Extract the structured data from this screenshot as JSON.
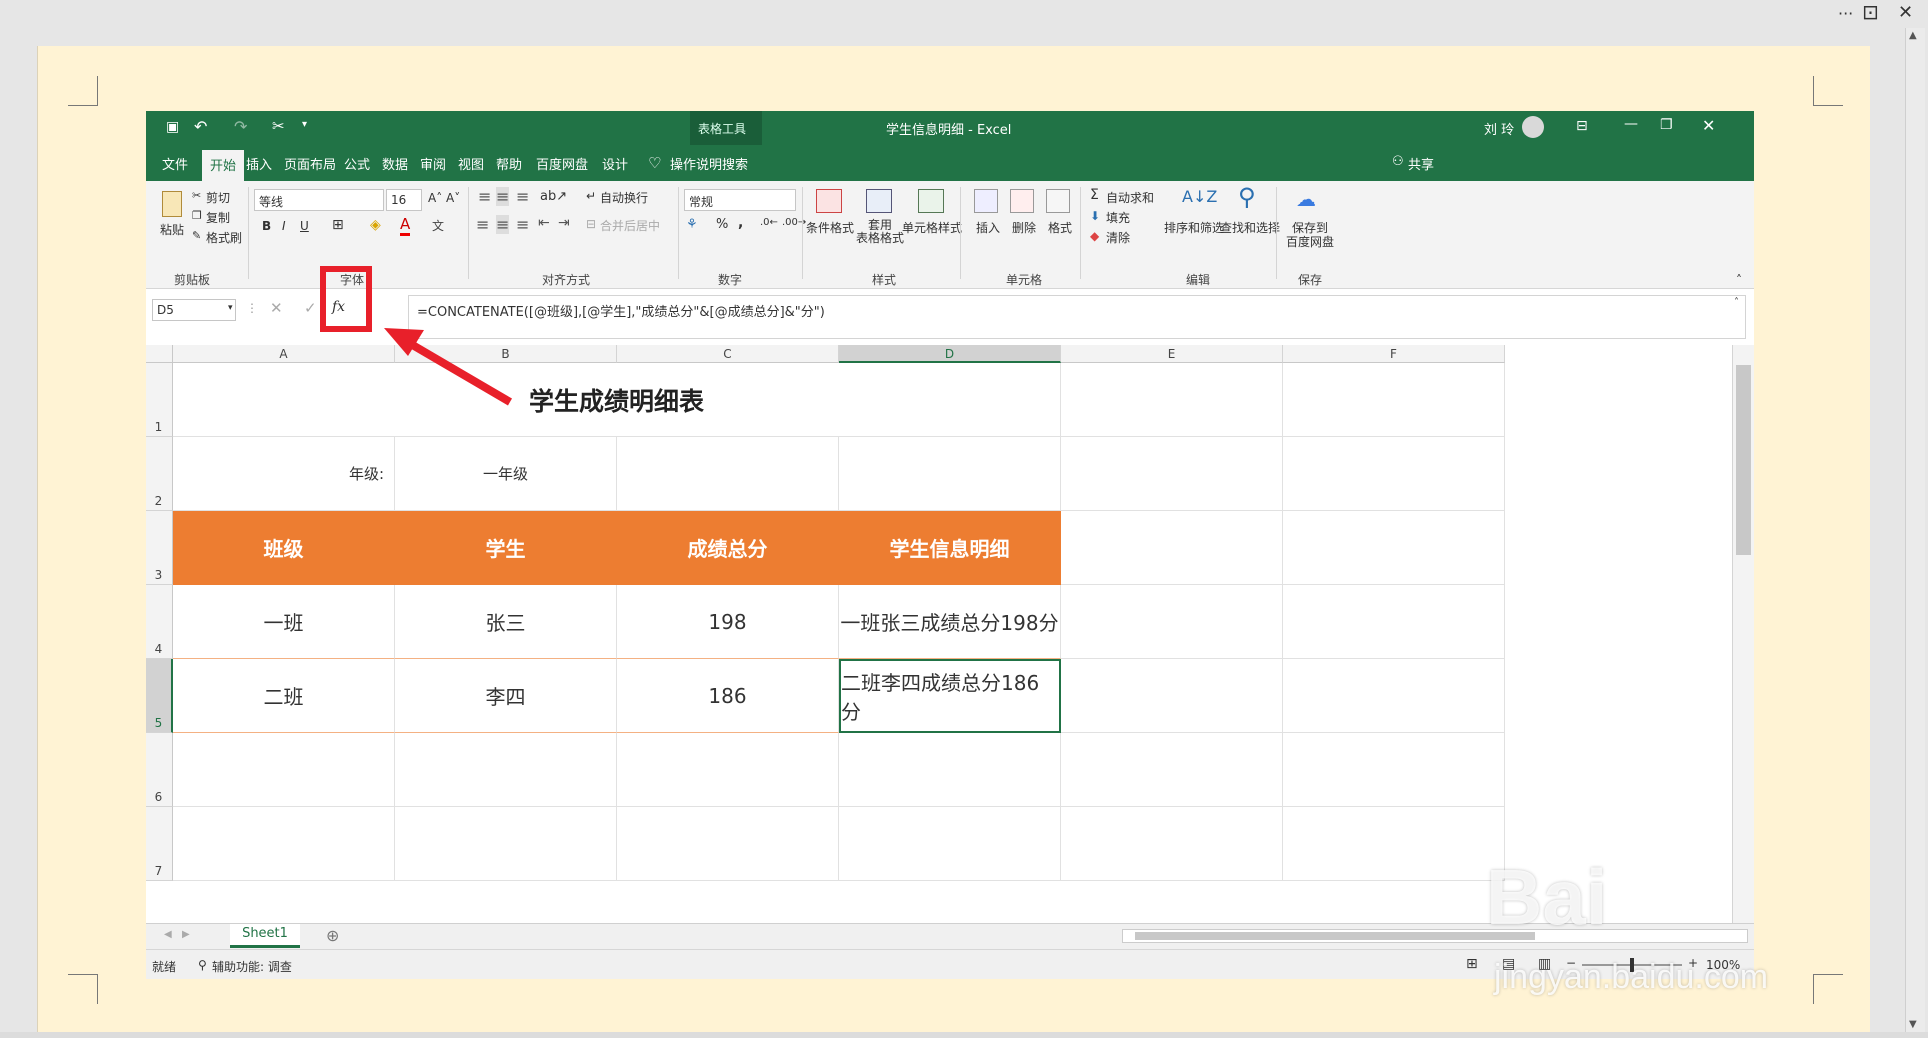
{
  "window": {
    "more": "···",
    "restore": "⊡",
    "close": "✕"
  },
  "excel": {
    "title": "学生信息明细 - Excel",
    "context_tool": "表格工具",
    "user": "刘 玲",
    "tabs": [
      "文件",
      "开始",
      "插入",
      "页面布局",
      "公式",
      "数据",
      "审阅",
      "视图",
      "帮助",
      "百度网盘",
      "设计"
    ],
    "tell_me": "操作说明搜索",
    "share": "共享",
    "ribbon": {
      "clipboard": {
        "paste": "粘贴",
        "cut": "剪切",
        "copy": "复制",
        "format_painter": "格式刷",
        "group": "剪贴板"
      },
      "font": {
        "name": "等线",
        "size": "16",
        "bold": "B",
        "italic": "I",
        "underline": "U",
        "group": "字体"
      },
      "alignment": {
        "wrap": "自动换行",
        "merge": "合并后居中",
        "group": "对齐方式"
      },
      "number": {
        "format": "常规",
        "percent": "%",
        "comma": ",",
        "group": "数字"
      },
      "styles": {
        "conditional": "条件格式",
        "table": "套用\n表格格式",
        "cell_styles": "单元格样式",
        "group": "样式"
      },
      "cells": {
        "insert": "插入",
        "delete": "删除",
        "format": "格式",
        "group": "单元格"
      },
      "editing": {
        "autosum": "自动求和",
        "fill": "填充",
        "clear": "清除",
        "sort": "排序和筛选",
        "find": "查找和选择",
        "group": "编辑"
      },
      "save": {
        "label1": "保存到",
        "label2": "百度网盘",
        "group": "保存"
      }
    },
    "name_box": "D5",
    "formula": "=CONCATENATE([@班级],[@学生],\"成绩总分\"&[@成绩总分]&\"分\")",
    "fx": "fx",
    "columns": [
      "A",
      "B",
      "C",
      "D",
      "E",
      "F"
    ],
    "rows": [
      "1",
      "2",
      "3",
      "4",
      "5",
      "6",
      "7"
    ],
    "sheet_title": "学生成绩明细表",
    "grade_label": "年级:",
    "grade_value": "一年级",
    "headers": [
      "班级",
      "学生",
      "成绩总分",
      "学生信息明细"
    ],
    "table": [
      [
        "一班",
        "张三",
        "198",
        "一班张三成绩总分198分"
      ],
      [
        "二班",
        "李四",
        "186",
        "二班李四成绩总分186分"
      ]
    ],
    "sheet_tab": "Sheet1",
    "status": {
      "ready": "就绪",
      "accessibility": "辅助功能: 调查",
      "zoom": "100%"
    },
    "accent": "#217346",
    "header_fill": "#ed7d31"
  },
  "watermark": {
    "line1": "Bai",
    "line2": "jingyan.baidu.com"
  }
}
